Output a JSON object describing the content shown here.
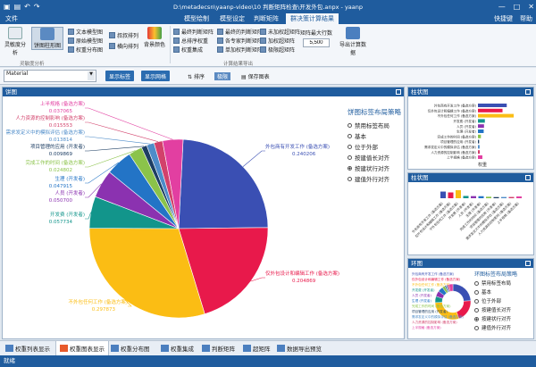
{
  "window": {
    "title": "D:\\metadecsn\\yaanp-video\\10 判断矩阵检查\\开发外包.anpx - yaanp"
  },
  "menu": {
    "file": "文件",
    "tabs": [
      "模型绘制",
      "模型设定",
      "判断矩阵",
      "群决策计算结果"
    ],
    "right": [
      "快捷键",
      "帮助"
    ]
  },
  "ribbon": {
    "big_buttons": [
      "灵敏度分析",
      "饼图柱形图",
      "背景颜色",
      "导出计算数据"
    ],
    "small_buttons": [
      "文本模型图",
      "原始模型图",
      "权重分布图",
      "叔叔排列",
      "横向排列",
      "最终判断矩阵",
      "总排序权重",
      "权重集成",
      "最终的判断矩阵",
      "各专家判断矩阵",
      "单加权判断矩阵",
      "未加权超矩阵",
      "加权超矩阵",
      "极限超矩阵"
    ],
    "group_labels": [
      "灵敏度分析",
      "计算结果导出"
    ],
    "iter_label": "矩阵最大行数",
    "iter_value": "5,500"
  },
  "toolbar2": {
    "select_value": "Material",
    "buttons": [
      "显示标签",
      "显示网格"
    ],
    "items": [
      "排序",
      "极限",
      "保存图表"
    ]
  },
  "pie_panel": {
    "title": "饼图",
    "legend_title": "饼图标签布局策略",
    "legend_options": [
      "禁用标签布局",
      "基本",
      "位于外部",
      "按建值长对齐",
      "按建状行对齐",
      "建值外行对齐"
    ],
    "selected_option_index": 4
  },
  "chart_data": {
    "type": "pie",
    "slices": [
      {
        "name": "外包商有开发工作 (备选方案)",
        "value": 0.240206,
        "color": "#3a4fb3"
      },
      {
        "name": "仅外包设计和编辑工作 (备选方案)",
        "value": 0.204869,
        "color": "#e8194b"
      },
      {
        "name": "不外包任何工作 (备选方案)",
        "value": 0.297873,
        "color": "#fbbd14"
      },
      {
        "name": "开发费 (开发者)",
        "value": 0.057734,
        "color": "#12958b"
      },
      {
        "name": "人员 (开发者)",
        "value": 0.0507,
        "color": "#8b32b0"
      },
      {
        "name": "生理 (开发者)",
        "value": 0.047915,
        "color": "#2374c6"
      },
      {
        "name": "完成工作的时间 (备选方案)",
        "value": 0.024802,
        "color": "#8bc34a"
      },
      {
        "name": "项目管理的应用 (开发者)",
        "value": 0.009869,
        "color": "#1d3e63"
      },
      {
        "name": "需求发定义中的模拟评估 (备选方案)",
        "value": 0.013814,
        "color": "#4e8cc9"
      },
      {
        "name": "人力资源的控制影响 (备选方案)",
        "value": 0.015553,
        "color": "#d2416b"
      },
      {
        "name": "上半规格 (备选方案)",
        "value": 0.037065,
        "color": "#e23fa1"
      }
    ]
  },
  "side_panels": {
    "bar_title": "柱状图",
    "bar2_title": "柱状图",
    "ring_title": "环图",
    "ring_legend_title": "环图标签布局策略",
    "bar_axis_label": "权重"
  },
  "bottom_tabs": [
    "权重列表显示",
    "权重图表显示",
    "权重分布图",
    "权重集成",
    "判断矩阵",
    "超矩阵",
    "数据导出预览"
  ],
  "status": "就绪"
}
